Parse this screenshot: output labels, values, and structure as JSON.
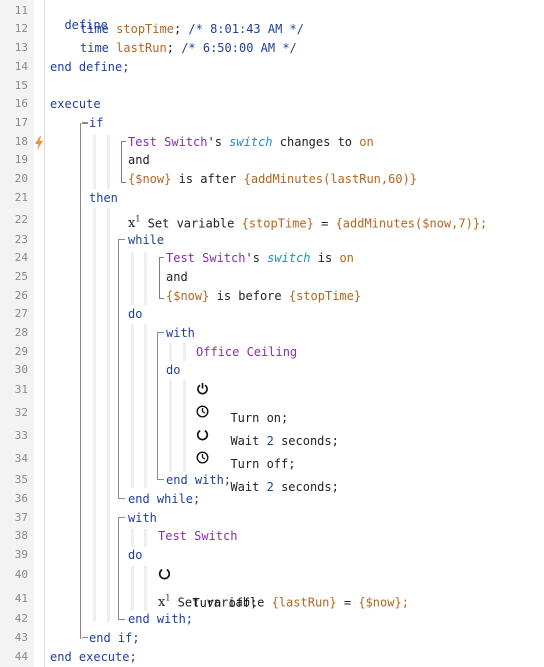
{
  "line_numbers": [
    "11",
    "12",
    "13",
    "14",
    "15",
    "16",
    "17",
    "18",
    "19",
    "20",
    "21",
    "22",
    "23",
    "24",
    "25",
    "26",
    "27",
    "28",
    "29",
    "30",
    "31",
    "32",
    "33",
    "34",
    "35",
    "36",
    "37",
    "38",
    "39",
    "40",
    "41",
    "42",
    "43",
    "44"
  ],
  "code": {
    "define": "define",
    "time_kw": "time",
    "stop_var": "stopTime",
    "stop_comment": "/* 8:01:43 AM */",
    "last_var": "lastRun",
    "last_comment": "/* 6:50:00 AM */",
    "end_define": "end define;",
    "execute": "execute",
    "if": "if",
    "test_switch": "Test Switch",
    "possessive": "'s",
    "switch_attr": "switch",
    "changes_to": "changes to",
    "on_val": "on",
    "and": "and",
    "now_expr": "{$now}",
    "is_after": "is after",
    "add_minutes_lastrun": "{addMinutes(lastRun,60)}",
    "then": "then",
    "set_variable": "Set variable",
    "stoptime_ref": "{stopTime}",
    "equals": "=",
    "add_minutes_now": "{addMinutes($now,7)};",
    "while": "while",
    "is": "is",
    "is_before": "is before",
    "do": "do",
    "with": "with",
    "office_ceiling": "Office Ceiling",
    "turn_on": "Turn on;",
    "wait": "Wait",
    "wait_num": "2",
    "seconds": "seconds;",
    "turn_off": "Turn off;",
    "end_with": "end with;",
    "end_while": "end while;",
    "lastrun_ref": "{lastRun}",
    "now_value": "{$now};",
    "end_if": "end if;",
    "end_execute": "end execute;",
    "variable_icon": "x",
    "variable_icon_sup": "1",
    "semicolon": ";"
  },
  "icons": {
    "lightning": "lightning-icon",
    "power": "power-icon",
    "clock": "clock-icon",
    "off": "power-off-icon",
    "variable": "variable-icon"
  },
  "colors": {
    "keyword": "#1f3f9a",
    "variable": "#b5651d",
    "device": "#8b2ea8",
    "attribute": "#1d8fbf",
    "lightning": "#f0922b"
  }
}
